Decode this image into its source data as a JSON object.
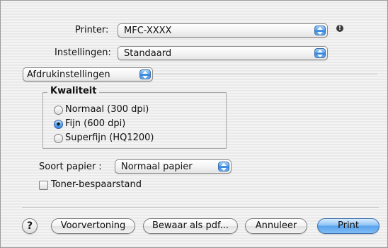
{
  "printer": {
    "label": "Printer:",
    "value": "MFC-XXXX",
    "status_icon": "alert-icon"
  },
  "presets": {
    "label": "Instellingen:",
    "value": "Standaard"
  },
  "panel_selector": {
    "value": "Afdrukinstellingen"
  },
  "quality": {
    "title": "Kwaliteit",
    "options": [
      {
        "label": "Normaal (300 dpi)",
        "selected": false
      },
      {
        "label": "Fijn (600 dpi)",
        "selected": true
      },
      {
        "label": "Superfijn (HQ1200)",
        "selected": false
      }
    ]
  },
  "paper_type": {
    "label": "Soort papier :",
    "value": "Normaal papier"
  },
  "toner_save": {
    "label": "Toner-bespaarstand",
    "checked": false
  },
  "buttons": {
    "help": "?",
    "preview": "Voorvertoning",
    "save_pdf": "Bewaar als pdf...",
    "cancel": "Annuleer",
    "print": "Print"
  },
  "colors": {
    "accent": "#4e9ae8",
    "window_bg": "#efefef"
  }
}
